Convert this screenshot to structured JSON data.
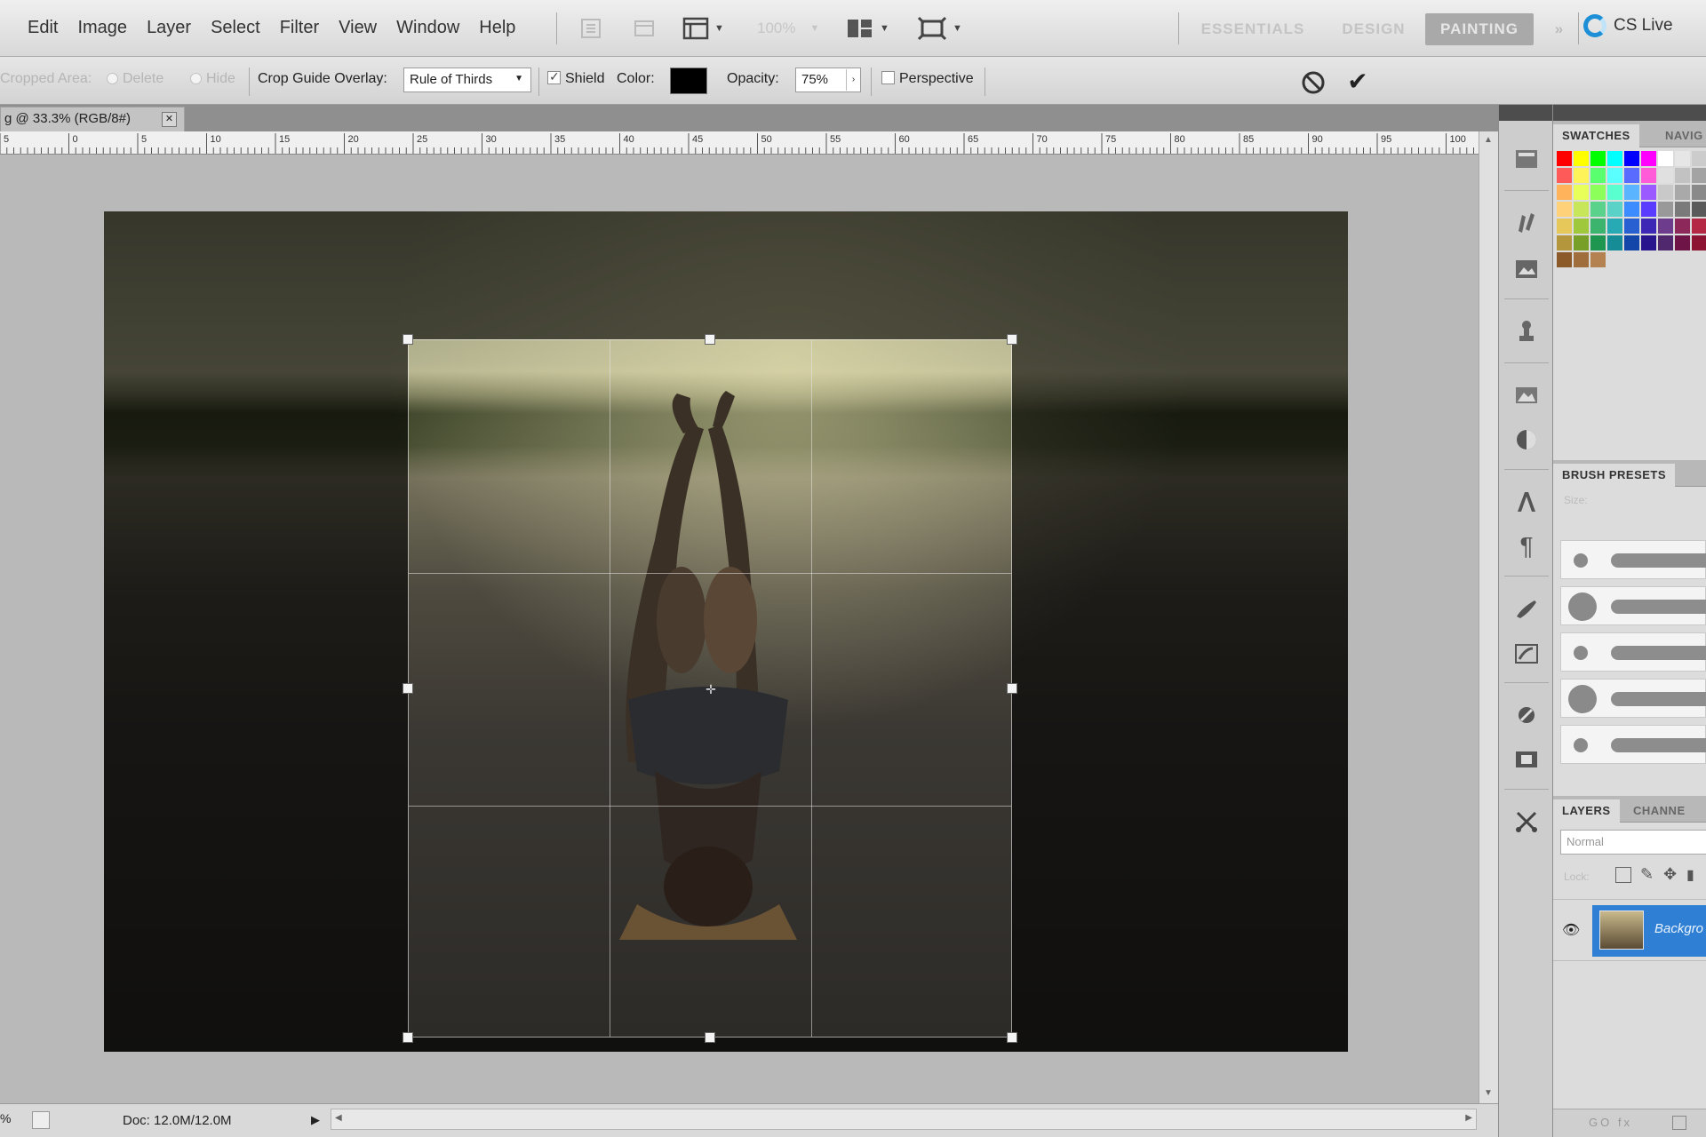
{
  "menubar": {
    "menus": [
      "Edit",
      "Image",
      "Layer",
      "Select",
      "Filter",
      "View",
      "Window",
      "Help"
    ],
    "zoom_value": "100%",
    "workspaces": [
      {
        "label": "ESSENTIALS",
        "active": false
      },
      {
        "label": "DESIGN",
        "active": false
      },
      {
        "label": "PAINTING",
        "active": true
      }
    ],
    "more_workspaces": "»",
    "cs_live": "CS Live"
  },
  "options": {
    "cropped_area_label": "Cropped Area:",
    "delete_label": "Delete",
    "hide_label": "Hide",
    "crop_guide_label": "Crop Guide Overlay:",
    "crop_guide_value": "Rule of Thirds",
    "shield_label": "Shield",
    "shield_checked": true,
    "color_label": "Color:",
    "shield_color": "#000000",
    "opacity_label": "Opacity:",
    "opacity_value": "75%",
    "perspective_label": "Perspective",
    "perspective_checked": false
  },
  "document": {
    "tab_title": "g @ 33.3% (RGB/8#)",
    "ruler_labels": [
      "5",
      "0",
      "5",
      "10",
      "15",
      "20",
      "25",
      "30",
      "35",
      "40",
      "45",
      "50",
      "55",
      "60",
      "65",
      "70",
      "75",
      "80",
      "85",
      "90",
      "95",
      "100"
    ],
    "status_zoom": "%",
    "status_doc": "Doc: 12.0M/12.0M"
  },
  "panels": {
    "swatches_tab": "SWATCHES",
    "navigator_tab": "NAVIG",
    "brush_presets_tab": "BRUSH PRESETS",
    "brush_size_label": "Size:",
    "layers_tab": "LAYERS",
    "channels_tab": "CHANNE",
    "blend_mode": "Normal",
    "lock_label": "Lock:",
    "layer_name": "Backgro",
    "footer_links": "GO fx"
  },
  "colors": {
    "accent": "#2f7fd5",
    "active_workspace": "#a9a9a9",
    "cs_live_ring": "#1d8fd6"
  },
  "icons": [
    "search-icon",
    "cancel-crop-icon",
    "commit-crop-icon",
    "eye-icon"
  ]
}
